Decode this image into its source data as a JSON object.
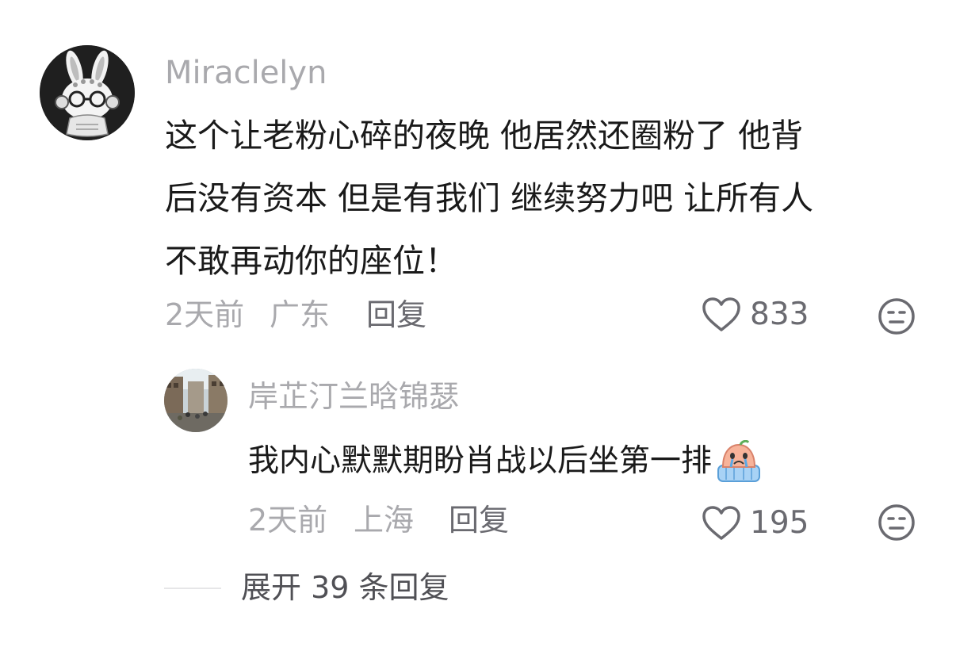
{
  "comment": {
    "username": "Miraclelyn",
    "lines": [
      "这个让老粉心碎的夜晚 他居然还圈粉了 他背",
      "后没有资本 但是有我们 继续努力吧 让所有人",
      "不敢再动你的座位！"
    ],
    "time": "2天前",
    "location": "广东",
    "reply_label": "回复",
    "like_count": "833",
    "avatar_icon": "bunny-avatar-icon"
  },
  "reply": {
    "username": "岸芷汀兰晗锦瑟",
    "text": "我内心默默期盼肖战以后坐第一排",
    "emoji_icon": "crying-emoji-icon",
    "time": "2天前",
    "location": "上海",
    "reply_label": "回复",
    "like_count": "195",
    "avatar_icon": "street-photo-avatar"
  },
  "expand": {
    "label": "展开 39 条回复"
  },
  "colors": {
    "primary_text": "#1a1a1a",
    "secondary_text": "#a9a9ad",
    "action_text": "#6a6a70"
  }
}
